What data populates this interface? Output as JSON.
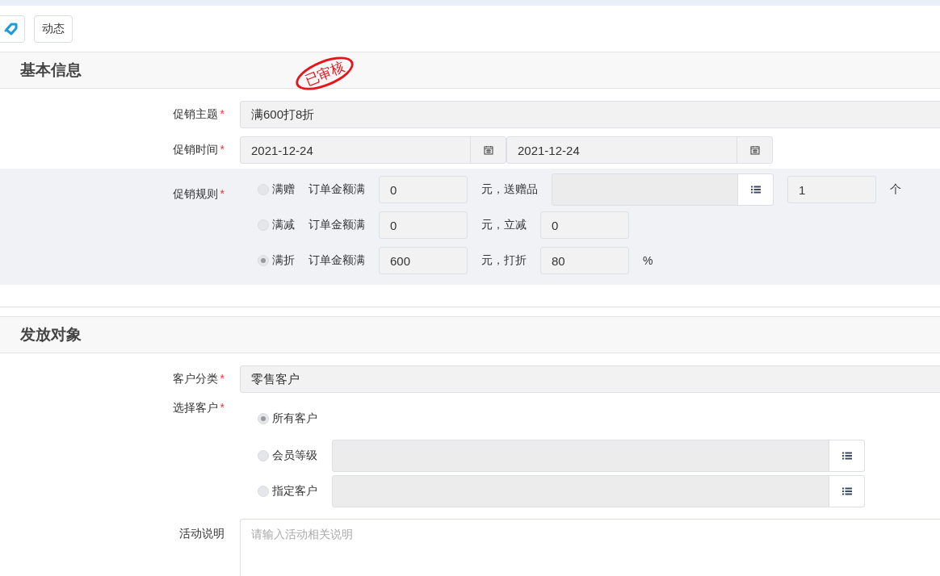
{
  "toolbar": {
    "dynamic_button": "动态"
  },
  "sections": [
    {
      "title": "基本信息",
      "stamp": "已审核",
      "fields": [
        {
          "kind": "text",
          "label": "促销主题",
          "required_mark": "*",
          "value": "满600打8折"
        },
        {
          "kind": "date_range",
          "label": "促销时间",
          "required_mark": "*",
          "start": "2021-12-24",
          "end": "2021-12-24"
        },
        {
          "kind": "rules",
          "label": "促销规则",
          "required_mark": "*",
          "options": [
            {
              "name": "满赠",
              "selected": false,
              "parts": [
                {
                  "kind": "text",
                  "text": "订单金额满"
                },
                {
                  "kind": "input",
                  "value": "0"
                },
                {
                  "kind": "text",
                  "text": "元，送赠品"
                },
                {
                  "kind": "picker"
                },
                {
                  "kind": "input",
                  "value": "1"
                },
                {
                  "kind": "text",
                  "text": "个"
                }
              ]
            },
            {
              "name": "满减",
              "selected": false,
              "parts": [
                {
                  "kind": "text",
                  "text": "订单金额满"
                },
                {
                  "kind": "input",
                  "value": "0"
                },
                {
                  "kind": "text",
                  "text": "元，立减"
                },
                {
                  "kind": "input",
                  "value": "0"
                }
              ]
            },
            {
              "name": "满折",
              "selected": true,
              "parts": [
                {
                  "kind": "text",
                  "text": "订单金额满"
                },
                {
                  "kind": "input",
                  "value": "600"
                },
                {
                  "kind": "text",
                  "text": "元，打折"
                },
                {
                  "kind": "input",
                  "value": "80"
                },
                {
                  "kind": "text",
                  "text": "%"
                }
              ]
            }
          ]
        }
      ]
    },
    {
      "title": "发放对象",
      "fields": [
        {
          "kind": "text",
          "label": "客户分类",
          "required_mark": "*",
          "value": "零售客户"
        },
        {
          "kind": "choice",
          "label": "选择客户",
          "required_mark": "*",
          "options": [
            {
              "name": "所有客户",
              "selected": true,
              "kind": "plain"
            },
            {
              "name": "会员等级",
              "selected": false,
              "kind": "picker"
            },
            {
              "name": "指定客户",
              "selected": false,
              "kind": "picker"
            }
          ]
        },
        {
          "kind": "textarea",
          "label": "活动说明",
          "placeholder": "请输入活动相关说明"
        }
      ]
    }
  ]
}
